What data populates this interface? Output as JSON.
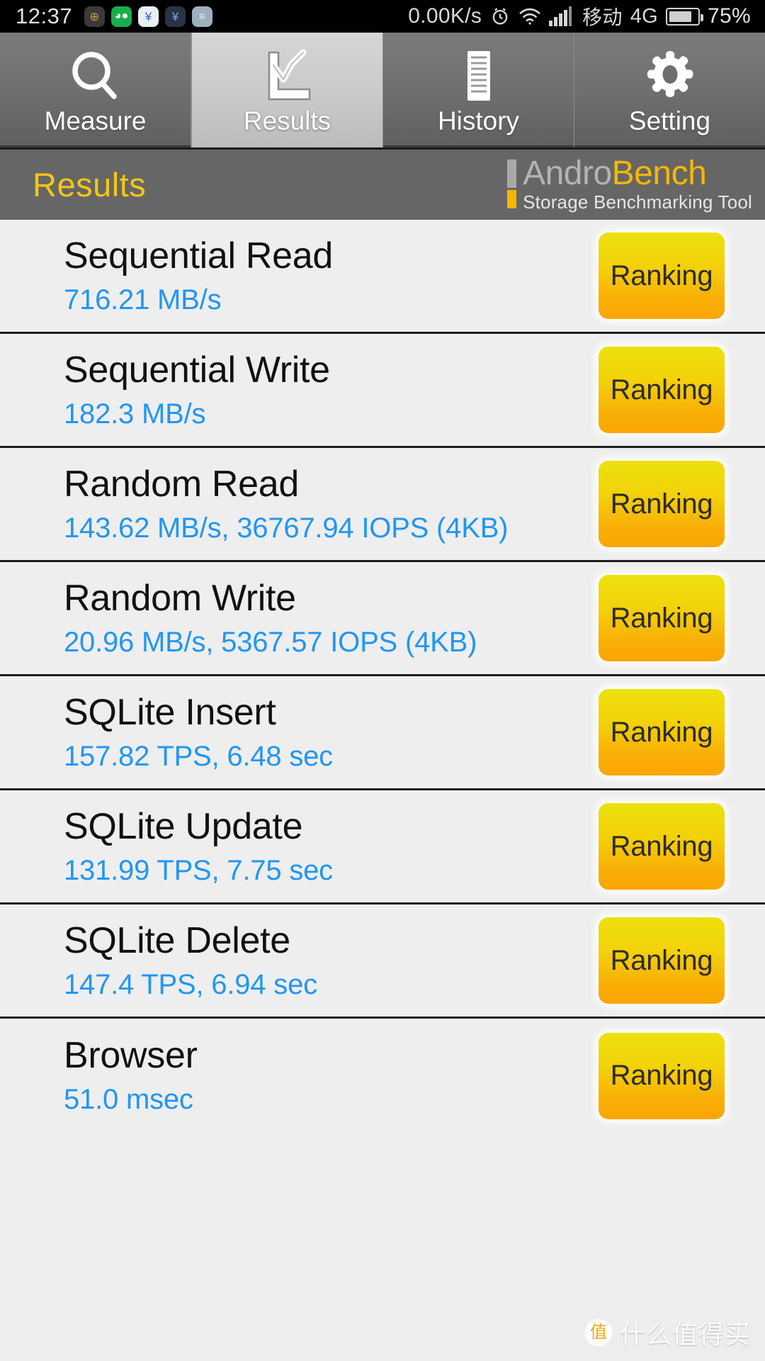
{
  "statusbar": {
    "time": "12:37",
    "app_icons": [
      {
        "name": "security-shield-icon",
        "glyph": "⊕"
      },
      {
        "name": "wechat-icon",
        "glyph": "◕"
      },
      {
        "name": "alipay-security-icon",
        "glyph": "¥"
      },
      {
        "name": "alipay-security-dark-icon",
        "glyph": "¥"
      },
      {
        "name": "list-lines-icon",
        "glyph": "≡"
      }
    ],
    "network_speed": "0.00K/s",
    "alarm_icon": "alarm-icon",
    "wifi_icon": "wifi-icon",
    "signal_icon": "signal-bars-icon",
    "carrier": "移动",
    "network_type": "4G",
    "battery_icon": "battery-icon",
    "battery_percent": "75%",
    "battery_level": 75
  },
  "tabs": [
    {
      "label": "Measure",
      "icon": "magnifier-icon",
      "active": false
    },
    {
      "label": "Results",
      "icon": "line-chart-icon",
      "active": true
    },
    {
      "label": "History",
      "icon": "document-lines-icon",
      "active": false
    },
    {
      "label": "Setting",
      "icon": "gear-icon",
      "active": false
    }
  ],
  "header": {
    "title": "Results",
    "title_color": "#f5c518",
    "logo_andro": "Andro",
    "logo_bench": "Bench",
    "logo_tagline": "Storage Benchmarking Tool",
    "logo_accent_color": "#f5b800",
    "logo_grey_color": "#b3b3b3"
  },
  "results": {
    "button_label": "Ranking",
    "value_color": "#2196f3",
    "rows": [
      {
        "title": "Sequential Read",
        "value": "716.21 MB/s"
      },
      {
        "title": "Sequential Write",
        "value": "182.3 MB/s"
      },
      {
        "title": "Random Read",
        "value": "143.62 MB/s, 36767.94 IOPS (4KB)"
      },
      {
        "title": "Random Write",
        "value": "20.96 MB/s, 5367.57 IOPS (4KB)"
      },
      {
        "title": "SQLite Insert",
        "value": "157.82 TPS, 6.48 sec"
      },
      {
        "title": "SQLite Update",
        "value": "131.99 TPS, 7.75 sec"
      },
      {
        "title": "SQLite Delete",
        "value": "147.4 TPS, 6.94 sec"
      },
      {
        "title": "Browser",
        "value": "51.0 msec"
      }
    ]
  },
  "watermark": {
    "badge": "值",
    "text": "什么值得买"
  }
}
